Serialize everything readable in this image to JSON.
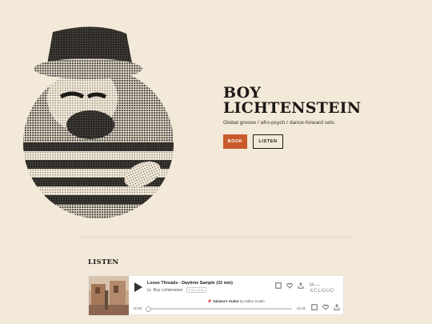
{
  "artist": {
    "name_line1": "BOY",
    "name_line2": "LICHTENSTEIN",
    "tagline": "Global groove / afro-psych / dance-forward sets"
  },
  "actions": {
    "book_label": "BOOK",
    "listen_label": "LISTEN"
  },
  "listen_section": {
    "title": "LISTEN"
  },
  "player": {
    "track_title": "Loose Threads - Daytime Sample (32 min)",
    "by_prefix": "by",
    "artist_link": "Boy Lichtenstein",
    "follow_label": "FOLLOW",
    "logo_text": "M—XCLOUD",
    "now_playing_track": "Salatsu's Guitar",
    "now_playing_by": "by Gábor Szabó",
    "time_elapsed": "00:00",
    "time_remaining": "-32:36",
    "progress": 0
  },
  "colors": {
    "background": "#f3e9d8",
    "accent": "#c95a2b",
    "ink": "#1c1917"
  }
}
